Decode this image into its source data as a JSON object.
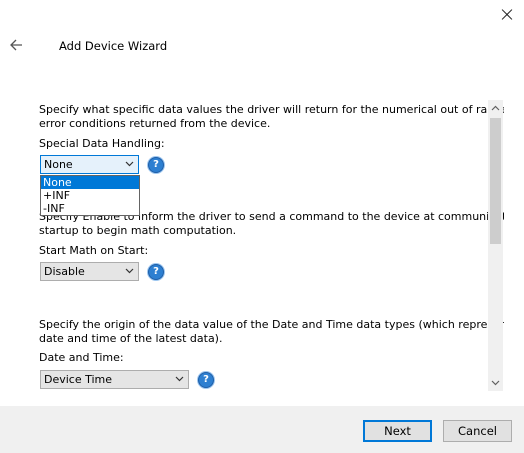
{
  "window": {
    "title": "Add Device Wizard"
  },
  "special_data": {
    "description_line1": "Specify what specific data values the driver will return for the numerical out of range and",
    "description_line2": "error conditions returned from the device.",
    "label": "Special Data Handling:",
    "selected": "None",
    "options": [
      "None",
      "+INF",
      "-INF"
    ]
  },
  "math_on_start": {
    "description_line1_partial": "Specify Enable to inform the driver to send a command to the device at communication",
    "description_line2": "startup to begin math computation.",
    "label": "Start Math on Start:",
    "selected": "Disable"
  },
  "date_time": {
    "description_line1": "Specify the origin of the data value of the Date and Time data types (which represent the",
    "description_line2": "date and time of the latest data).",
    "label": "Date and Time:",
    "selected": "Device Time"
  },
  "buttons": {
    "next": "Next",
    "cancel": "Cancel"
  },
  "icons": {
    "close": "close-icon",
    "back": "back-arrow-icon",
    "help": "help-icon",
    "dropdown": "chevron-down-icon"
  },
  "colors": {
    "accent": "#0078d7",
    "help_icon": "#2d7fd1",
    "footer_bg": "#f0f0f0"
  }
}
